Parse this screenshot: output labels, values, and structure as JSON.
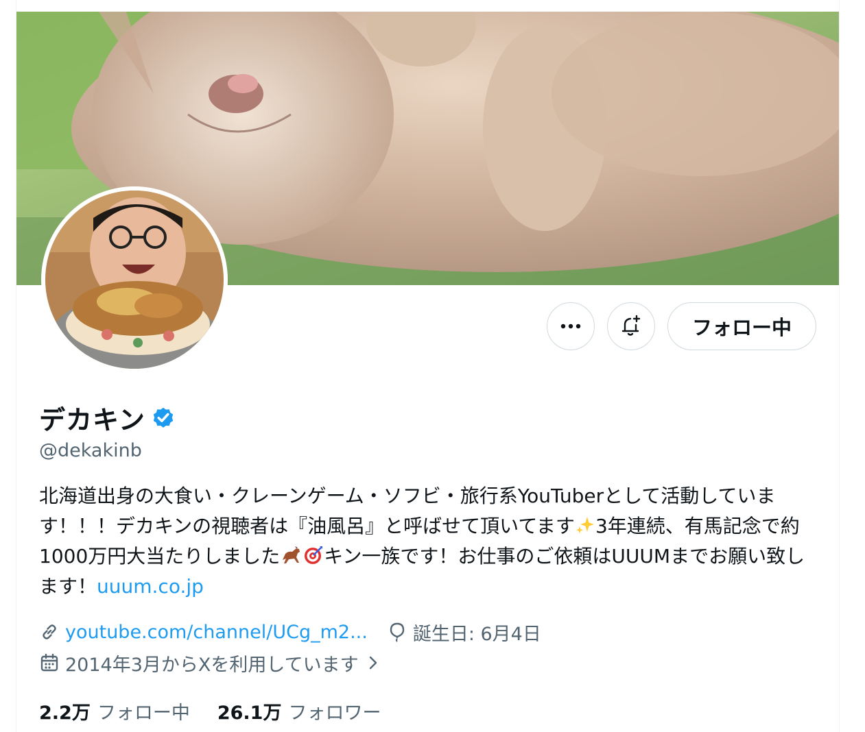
{
  "profile": {
    "display_name": "デカキン",
    "handle": "@dekakinb",
    "verified": true,
    "bio_text": "北海道出身の大食い・クレーンゲーム・ソフビ・旅行系YouTuberとして活動しています！！！デカキンの視聴者は『油風呂』と呼ばせて頂いてます",
    "bio_text_2": "3年連続、有馬記念で約1000万円大当たりしました",
    "bio_text_3": "キン一族です！お仕事のご依頼はUUUMまでお願い致します！",
    "bio_link": "uuum.co.jp"
  },
  "actions": {
    "more_icon": "more-horizontal-icon",
    "notify_icon": "bell-plus-icon",
    "follow_label": "フォロー中"
  },
  "meta": {
    "website": "youtube.com/channel/UCg_m2...",
    "birthday": "誕生日: 6月4日",
    "joined": "2014年3月からXを利用しています",
    "icons": {
      "website": "link-icon",
      "birthday": "balloon-icon",
      "joined": "calendar-icon",
      "joined_chevron": "chevron-right-icon"
    }
  },
  "stats": {
    "following_count": "2.2万",
    "following_label": "フォロー中",
    "followers_count": "26.1万",
    "followers_label": "フォロワー"
  },
  "colors": {
    "accent": "#1d9bf0",
    "text_primary": "#0f1419",
    "text_secondary": "#536471",
    "border": "#cfd9de"
  }
}
